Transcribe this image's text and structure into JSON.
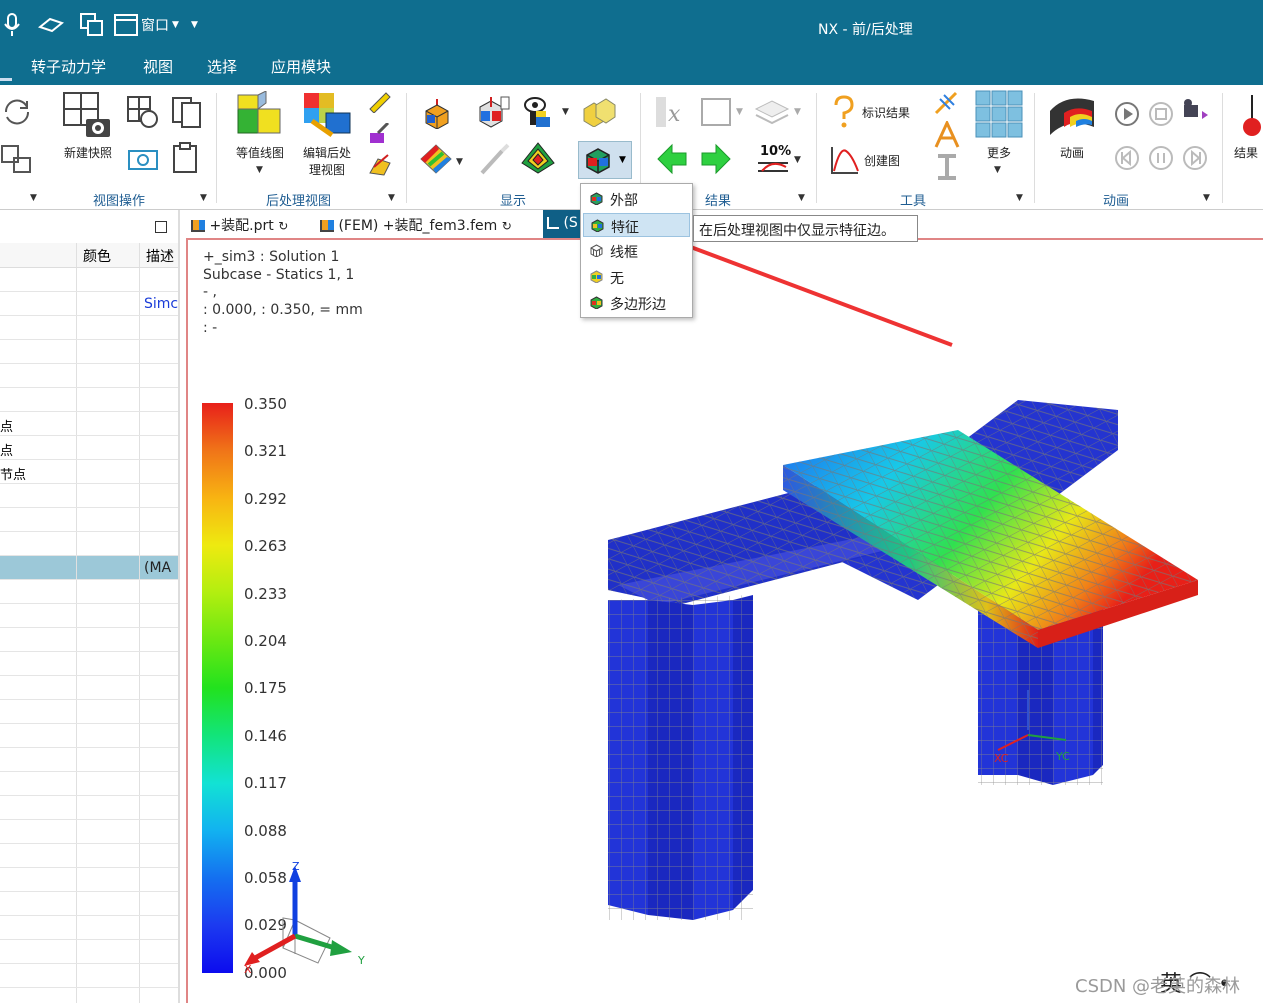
{
  "window": {
    "title": "NX - 前/后处理",
    "quick_access": {
      "window_label": "窗口"
    }
  },
  "menu": {
    "items": [
      "转子动力学",
      "视图",
      "选择",
      "应用模块"
    ]
  },
  "ribbon": {
    "groups": {
      "view_ops": "视图操作",
      "post_view": "后处理视图",
      "display": "显示",
      "results": "结果",
      "tools": "工具",
      "animation": "动画"
    },
    "labels": {
      "new_snapshot": "新建快照",
      "contour_plot": "等值线图",
      "edit_post_view_1": "编辑后处",
      "edit_post_view_2": "理视图",
      "identify_result": "标识结果",
      "create_graph": "创建图",
      "more": "更多",
      "animation": "动画",
      "result_cut": "结果"
    },
    "percent_label": "10%"
  },
  "tabs": [
    {
      "label": "+装配.prt"
    },
    {
      "label": "(FEM) +装配_fem3.fem"
    },
    {
      "label": "(S"
    }
  ],
  "navigator": {
    "columns": {
      "color": "颜色",
      "description": "描述"
    },
    "rows": [
      {
        "left": "",
        "desc": ""
      },
      {
        "left": "",
        "desc": "Simc"
      },
      {
        "left": "",
        "desc": ""
      },
      {
        "left": "",
        "desc": ""
      },
      {
        "left": "",
        "desc": ""
      },
      {
        "left": "",
        "desc": ""
      },
      {
        "left": "点",
        "desc": ""
      },
      {
        "left": "点",
        "desc": ""
      },
      {
        "left": "节点",
        "desc": ""
      },
      {
        "left": "",
        "desc": ""
      },
      {
        "left": "",
        "desc": ""
      },
      {
        "left": "",
        "desc": ""
      },
      {
        "left": "",
        "desc": "(MA"
      }
    ]
  },
  "display_menu": {
    "items": [
      {
        "label": "外部",
        "icon": "cube-exterior-icon"
      },
      {
        "label": "特征",
        "icon": "cube-feature-icon",
        "selected": true
      },
      {
        "label": "线框",
        "icon": "wireframe-icon"
      },
      {
        "label": "无",
        "icon": "cube-none-icon"
      },
      {
        "label": "多边形边",
        "icon": "polygon-edge-icon"
      }
    ],
    "tooltip": "在后处理视图中仅显示特征边。"
  },
  "viewport": {
    "info": {
      "line1": "+_sim3 : Solution 1",
      "line2": "Subcase - Statics 1,  1",
      "line3": " - ,",
      "line4": " : 0.000,  : 0.350,  = mm",
      "line5": " :  -"
    },
    "legend": {
      "values": [
        "0.350",
        "0.321",
        "0.292",
        "0.263",
        "0.233",
        "0.204",
        "0.175",
        "0.146",
        "0.117",
        "0.088",
        "0.058",
        "0.029",
        "0.000"
      ],
      "colors": [
        "#e8201a",
        "#f07418",
        "#f8b412",
        "#eeea10",
        "#b2ee10",
        "#6ae812",
        "#22e21e",
        "#12e47a",
        "#12e2d4",
        "#12b2f0",
        "#1470f0",
        "#1c3af0",
        "#0c0cee"
      ]
    },
    "triad": {
      "z": "Z",
      "x": "X",
      "y": "Y"
    },
    "model_triad": {
      "xc": "XC",
      "yc": "YC"
    }
  },
  "watermark": "CSDN @老英的森林"
}
